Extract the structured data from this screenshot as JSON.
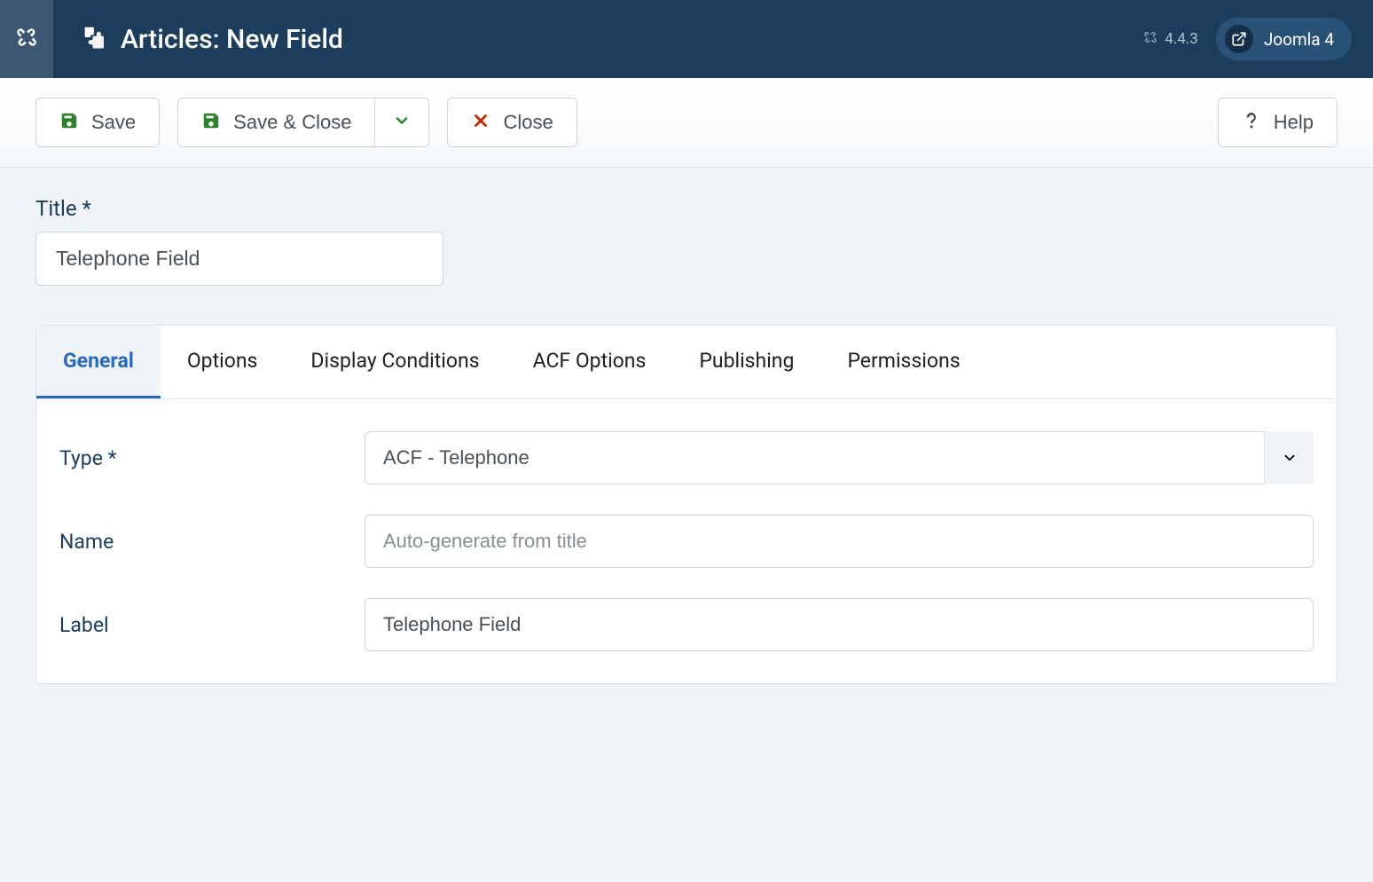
{
  "header": {
    "page_title": "Articles: New Field",
    "version": "4.4.3",
    "site_name": "Joomla 4"
  },
  "toolbar": {
    "save_label": "Save",
    "save_close_label": "Save & Close",
    "close_label": "Close",
    "help_label": "Help"
  },
  "title_field": {
    "label": "Title *",
    "value": "Telephone Field"
  },
  "tabs": [
    {
      "label": "General",
      "active": true
    },
    {
      "label": "Options",
      "active": false
    },
    {
      "label": "Display Conditions",
      "active": false
    },
    {
      "label": "ACF Options",
      "active": false
    },
    {
      "label": "Publishing",
      "active": false
    },
    {
      "label": "Permissions",
      "active": false
    }
  ],
  "form": {
    "type": {
      "label": "Type *",
      "value": "ACF - Telephone"
    },
    "name": {
      "label": "Name",
      "value": "",
      "placeholder": "Auto-generate from title"
    },
    "label_field": {
      "label": "Label",
      "value": "Telephone Field"
    }
  }
}
